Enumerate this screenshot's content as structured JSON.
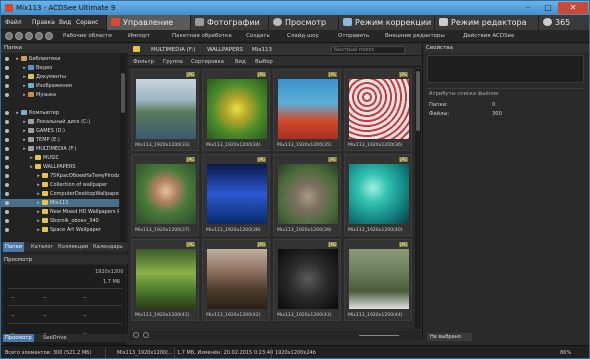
{
  "window": {
    "title": "Mix113 - ACDSee Ultimate 9"
  },
  "menus": [
    "Файл",
    "Правка",
    "Вид",
    "Сервис"
  ],
  "modes": [
    {
      "label": "Управление",
      "color": "#e04a32",
      "active": true
    },
    {
      "label": "Фотографии",
      "color": "#999999",
      "active": false
    },
    {
      "label": "Просмотр",
      "color": "#bbbbbb",
      "active": false
    },
    {
      "label": "Режим коррекции",
      "color": "#8fb9e0",
      "active": false
    },
    {
      "label": "Режим редактора",
      "color": "#cccccc",
      "active": false
    },
    {
      "label": "365",
      "color": "#cccccc",
      "active": false
    }
  ],
  "toolbar": {
    "workspaces": "Рабочие области",
    "items": [
      "Импорт",
      "Пакетная обработка",
      "Создать",
      "Слайд-шоу",
      "Отправить",
      "Внешние редакторы",
      "Действия ACDSee"
    ]
  },
  "folders_panel": {
    "title": "Папки",
    "tree": [
      {
        "label": "Библиотеки",
        "indent": 0,
        "icon": "library"
      },
      {
        "label": "Видео",
        "indent": 1,
        "icon": "video"
      },
      {
        "label": "Документы",
        "indent": 1,
        "icon": "docs"
      },
      {
        "label": "Изображения",
        "indent": 1,
        "icon": "images"
      },
      {
        "label": "Музыка",
        "indent": 1,
        "icon": "music"
      },
      {
        "label": "",
        "indent": 0,
        "icon": ""
      },
      {
        "label": "Компьютер",
        "indent": 0,
        "icon": "computer"
      },
      {
        "label": "Локальный диск (C:)",
        "indent": 1,
        "icon": "drive"
      },
      {
        "label": "GAMES (D:)",
        "indent": 1,
        "icon": "drive"
      },
      {
        "label": "TEMP (E:)",
        "indent": 1,
        "icon": "drive"
      },
      {
        "label": "MULTIMEDIA (F:)",
        "indent": 1,
        "icon": "drive"
      },
      {
        "label": "MUSIC",
        "indent": 2,
        "icon": "folder"
      },
      {
        "label": "WALLPAPERS",
        "indent": 2,
        "icon": "folder"
      },
      {
        "label": "75КрасОбоевНаТемуPiroda",
        "indent": 3,
        "icon": "folder"
      },
      {
        "label": "Collection of wallpaper",
        "indent": 3,
        "icon": "folder"
      },
      {
        "label": "ComputerDesktopWallpapersC",
        "indent": 3,
        "icon": "folder"
      },
      {
        "label": "Mix113",
        "indent": 3,
        "icon": "folder",
        "selected": true
      },
      {
        "label": "New Mixed HD Wallpapers Pa",
        "indent": 3,
        "icon": "folder"
      },
      {
        "label": "Sbornik_oboev_340",
        "indent": 3,
        "icon": "folder"
      },
      {
        "label": "Space Art Wallpaper",
        "indent": 3,
        "icon": "folder"
      }
    ],
    "tabs": [
      "Папки",
      "Каталог",
      "Коллекции",
      "Календарь"
    ]
  },
  "preview_panel": {
    "title": "Просмотр",
    "resolution": "1920x1200",
    "size": "1,7 МБ",
    "placeholders": [
      "--",
      "--",
      "--",
      "--",
      "--",
      "--",
      "--",
      "--",
      "--"
    ]
  },
  "bottom_left_tabs": [
    "Просмотр",
    "SeeDrive"
  ],
  "breadcrumb": [
    "MULTIMEDIA (F:)",
    "WALLPAPERS",
    "Mix113"
  ],
  "search": {
    "placeholder": "Быстрый поиск"
  },
  "filterbar": [
    "Фильтр",
    "Группа",
    "Сортировка",
    "Вид",
    "Выбор"
  ],
  "thumbnails": [
    {
      "caption": "Mix113_1920x1200(33)",
      "tag": "JPG",
      "scene": "lake"
    },
    {
      "caption": "Mix113_1920x1200(34)",
      "tag": "JPG",
      "scene": "butterfly"
    },
    {
      "caption": "Mix113_1920x1200(35)",
      "tag": "JPG",
      "scene": "coral"
    },
    {
      "caption": "Mix113_1920x1200(36)",
      "tag": "JPG",
      "scene": "pattern"
    },
    {
      "caption": "Mix113_1920x1200(37)",
      "tag": "JPG",
      "scene": "girl"
    },
    {
      "caption": "Mix113_1920x1200(38)",
      "tag": "JPG",
      "scene": "blue"
    },
    {
      "caption": "Mix113_1920x1200(39)",
      "tag": "JPG",
      "scene": "lion"
    },
    {
      "caption": "Mix113_1920x1200(40)",
      "tag": "JPG",
      "scene": "cyan"
    },
    {
      "caption": "Mix113_1920x1200(41)",
      "tag": "JPG",
      "scene": "forest"
    },
    {
      "caption": "Mix113_1920x1200(42)",
      "tag": "JPG",
      "scene": "moto"
    },
    {
      "caption": "Mix113_1920x1200(43)",
      "tag": "JPG",
      "scene": "dark"
    },
    {
      "caption": "Mix113_1920x1200(44)",
      "tag": "JPG",
      "scene": "horses"
    }
  ],
  "properties_panel": {
    "title": "Свойства",
    "attributes_label": "Атрибуты списка файлов",
    "rows": [
      {
        "label": "Папки:",
        "value": "0"
      },
      {
        "label": "Файлы:",
        "value": "300"
      }
    ],
    "bottom_tab": "Не выбрано"
  },
  "status": {
    "total": "Всего элементов: 300 (521,2 МБ)",
    "file": "Mix113_1920x1200(...",
    "info": "1,7 МБ, Изменён: 20.02.2015 0:23:40",
    "dims": "1920x1200x24b",
    "zoom": "86%"
  }
}
